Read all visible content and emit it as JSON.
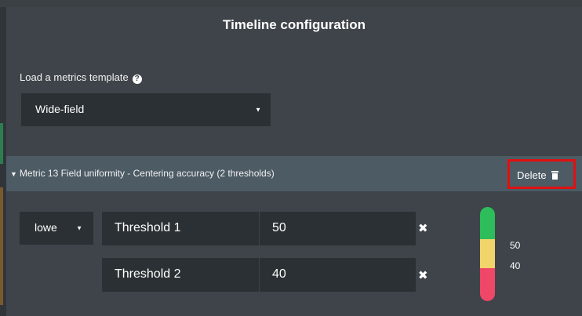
{
  "dialog": {
    "title": "Timeline configuration"
  },
  "template": {
    "label": "Load a metrics template",
    "help_icon": "?",
    "selected": "Wide-field"
  },
  "metric": {
    "toggle_icon": "▼",
    "text": "Metric 13  Field uniformity - Centering accuracy  (2 thresholds)",
    "delete_label": "Delete"
  },
  "operator": {
    "selected": "lowe"
  },
  "thresholds": [
    {
      "name": "Threshold 1",
      "value": "50",
      "remove_icon": "✖"
    },
    {
      "name": "Threshold 2",
      "value": "40",
      "remove_icon": "✖"
    }
  ],
  "gauge": {
    "labels": [
      "50",
      "40"
    ],
    "segments": [
      {
        "color": "#2dbd5a",
        "fraction": 0.34
      },
      {
        "color": "#f1d46a",
        "fraction": 0.31
      },
      {
        "color": "#ef4768",
        "fraction": 0.35
      }
    ]
  },
  "colors": {
    "panel": "#3e4449",
    "input": "#2b3034",
    "metric_bar": "#4d5b65",
    "highlight": "#e01010"
  }
}
